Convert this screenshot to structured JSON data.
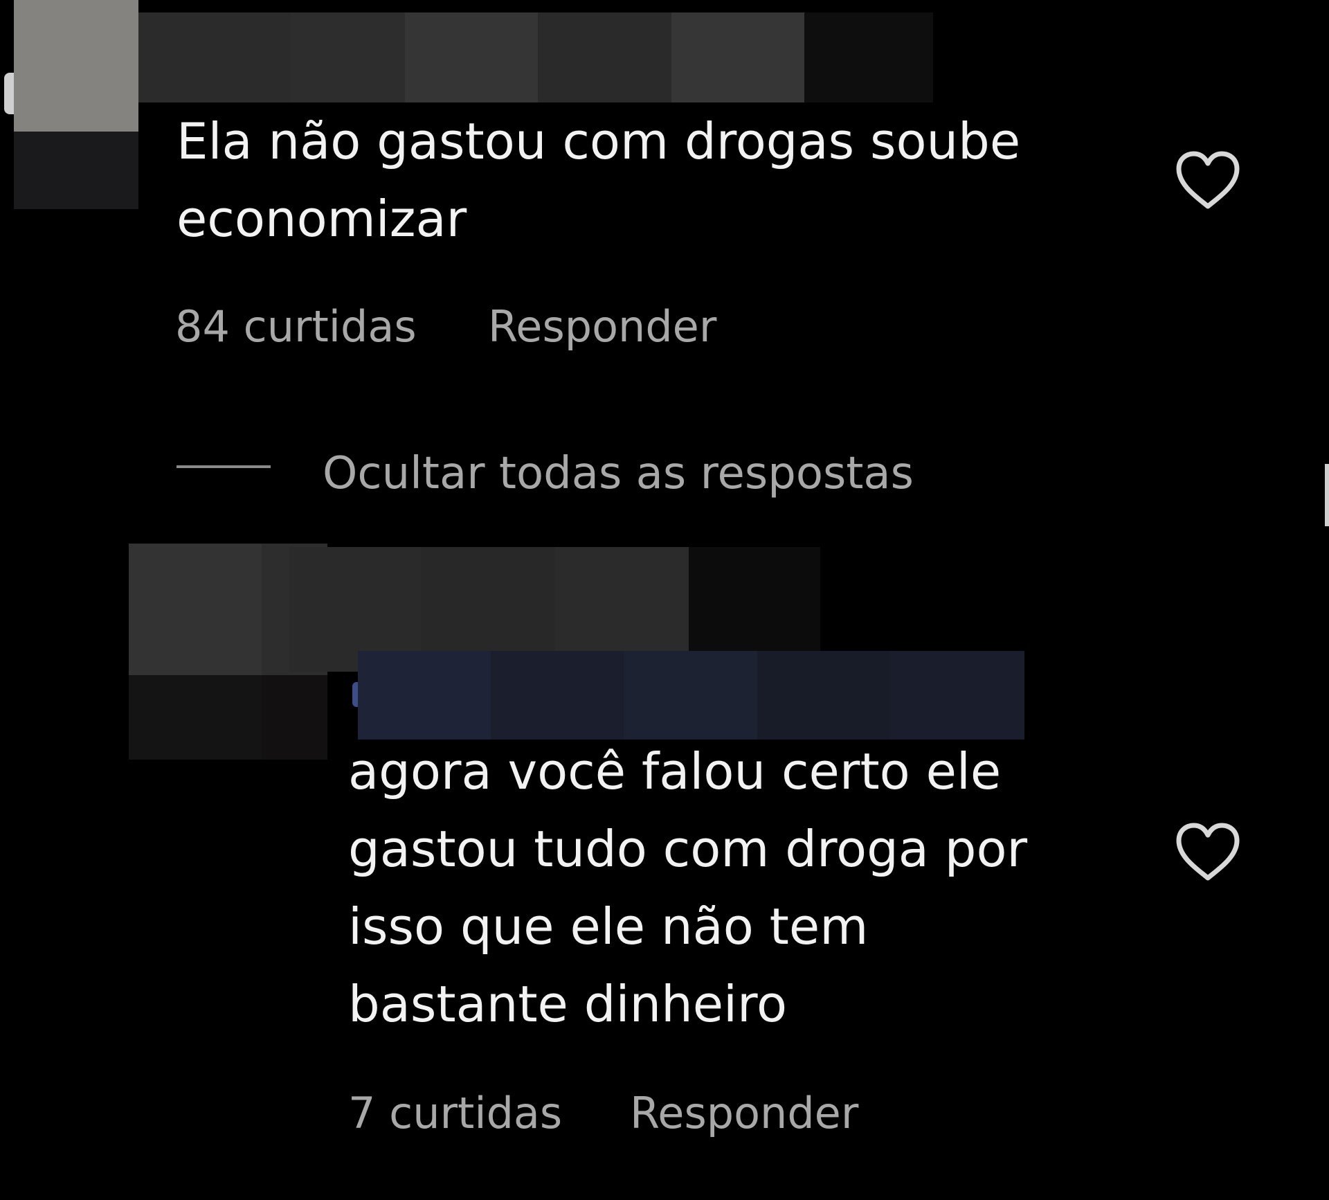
{
  "comments": [
    {
      "text": "Ela não gastou com drogas soube\neconomizar",
      "likes": "84 curtidas",
      "reply_label": "Responder"
    },
    {
      "text": "agora você falou certo ele\ngastou tudo com droga por\nisso que ele não tem\nbastante dinheiro",
      "likes": "7 curtidas",
      "reply_label": "Responder"
    }
  ],
  "replies_toggle": "Ocultar todas as respostas",
  "colors": {
    "background": "#000000",
    "text_primary": "#f2f2f2",
    "text_secondary": "#a8a8a8",
    "censor_mention": "#1c2233"
  },
  "icons": {
    "like": "heart-outline-icon"
  }
}
